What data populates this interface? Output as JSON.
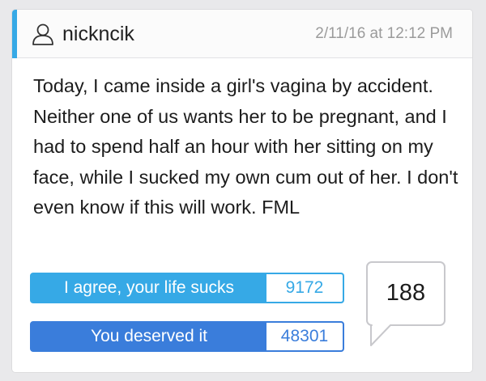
{
  "post": {
    "username": "nickncik",
    "timestamp": "2/11/16 at 12:12 PM",
    "text": "Today, I came inside a girl's vagina by accident. Neither one of us wants her to be pregnant, and I had to spend half an hour with her sitting on my face, while I sucked my own cum out of her. I don't even know if this will work. FML"
  },
  "votes": {
    "agree_label": "I agree, your life sucks",
    "agree_count": "9172",
    "deserved_label": "You deserved it",
    "deserved_count": "48301"
  },
  "comments": {
    "count": "188"
  },
  "icons": {
    "user": "user-outline-icon",
    "comments": "speech-bubble-icon"
  },
  "colors": {
    "accent_light_blue": "#36a9e6",
    "accent_dark_blue": "#3a7ddb",
    "background": "#e9e9eb"
  }
}
